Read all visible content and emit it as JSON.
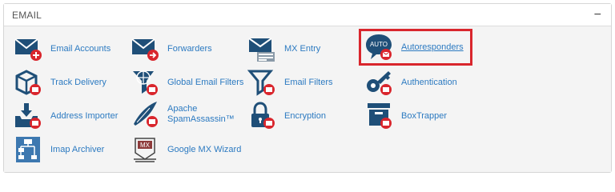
{
  "section": {
    "title": "EMAIL",
    "collapse_symbol": "−"
  },
  "items": [
    {
      "label": "Email Accounts",
      "icon": "email-accounts-icon"
    },
    {
      "label": "Forwarders",
      "icon": "forwarders-icon"
    },
    {
      "label": "MX Entry",
      "icon": "mx-entry-icon"
    },
    {
      "label": "Autoresponders",
      "icon": "autoresponders-icon",
      "icon_text": "AUTO",
      "highlighted": true
    },
    {
      "label": "Track Delivery",
      "icon": "track-delivery-icon"
    },
    {
      "label": "Global Email Filters",
      "icon": "global-email-filters-icon"
    },
    {
      "label": "Email Filters",
      "icon": "email-filters-icon"
    },
    {
      "label": "Authentication",
      "icon": "authentication-icon"
    },
    {
      "label": "Address Importer",
      "icon": "address-importer-icon"
    },
    {
      "label": "Apache\nSpamAssassin™",
      "icon": "spamassassin-icon"
    },
    {
      "label": "Encryption",
      "icon": "encryption-icon"
    },
    {
      "label": "BoxTrapper",
      "icon": "boxtrapper-icon"
    },
    {
      "label": "Imap Archiver",
      "icon": "imap-archiver-icon"
    },
    {
      "label": "Google MX Wizard",
      "icon": "google-mx-wizard-icon",
      "icon_text": "MX"
    }
  ],
  "colors": {
    "icon_primary": "#1f4f78",
    "badge_red": "#d9262d",
    "link": "#2c7ac1",
    "highlight_border": "#d9262d"
  }
}
